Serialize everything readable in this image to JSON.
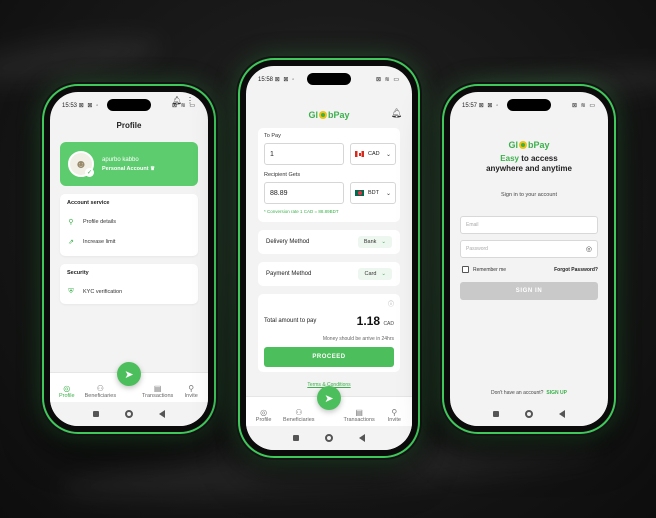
{
  "profile_screen": {
    "status_time": "15:53",
    "status_icons": "⊠ ⊠ ◦",
    "status_right": "⊠ ≋ ▭",
    "title": "Profile",
    "user_name": "apurbo kabbo",
    "account_type": "Personal Account",
    "account_service_title": "Account service",
    "account_items": [
      "Profile details",
      "Increase limit"
    ],
    "security_title": "Security",
    "security_items": [
      "KYC verification"
    ],
    "tabs": [
      "Profile",
      "Beneficiaries",
      "Transactions",
      "Invite"
    ]
  },
  "send_screen": {
    "status_time": "15:58",
    "status_icons": "⊠ ⊠ ◦",
    "status_right": "⊠ ≋ ▭",
    "logo_left": "Gl",
    "logo_right": "bPay",
    "to_pay_label": "To Pay",
    "to_pay_value": "1",
    "to_pay_currency": "CAD",
    "recipient_label": "Recipient Gets",
    "recipient_value": "88.89",
    "recipient_currency": "BDT",
    "conversion_note": "* Conversion rate 1 CAD = 88.89BDT",
    "delivery_label": "Delivery Method",
    "delivery_value": "Bank",
    "payment_label": "Payment Method",
    "payment_value": "Card",
    "total_label": "Total amount to pay",
    "total_value": "1.18",
    "total_currency": "CAD",
    "arrival_note": "Money should be arrive in 24hrs",
    "proceed_label": "PROCEED",
    "terms_label": "Terms & Conditions",
    "tabs": [
      "Profile",
      "Beneficiaries",
      "Transactions",
      "Invite"
    ]
  },
  "signin_screen": {
    "status_time": "15:57",
    "status_icons": "⊠ ⊠ ◦",
    "status_right": "⊠ ≋ ▭",
    "logo_left": "Gl",
    "logo_right": "bPay",
    "tagline_green": "Easy",
    "tagline_rest1": " to access",
    "tagline_line2": "anywhere and anytime",
    "subtitle": "Sign in to your account",
    "email_placeholder": "Email",
    "password_placeholder": "Password",
    "remember_label": "Remember me",
    "forgot_label": "Forgot Password?",
    "signin_label": "SIGN IN",
    "no_account": "Don't have an account?",
    "signup_label": "SIGN UP"
  },
  "colors": {
    "accent": "#4cbf5c",
    "card_green": "#5ccc6e",
    "glow": "#3ec95a"
  },
  "icons": {
    "bell": "bell-icon",
    "menu": "more-vertical-icon",
    "send": "send-icon",
    "profile": "user-icon",
    "beneficiaries": "users-icon",
    "transactions": "receipt-icon",
    "invite": "user-plus-icon"
  }
}
